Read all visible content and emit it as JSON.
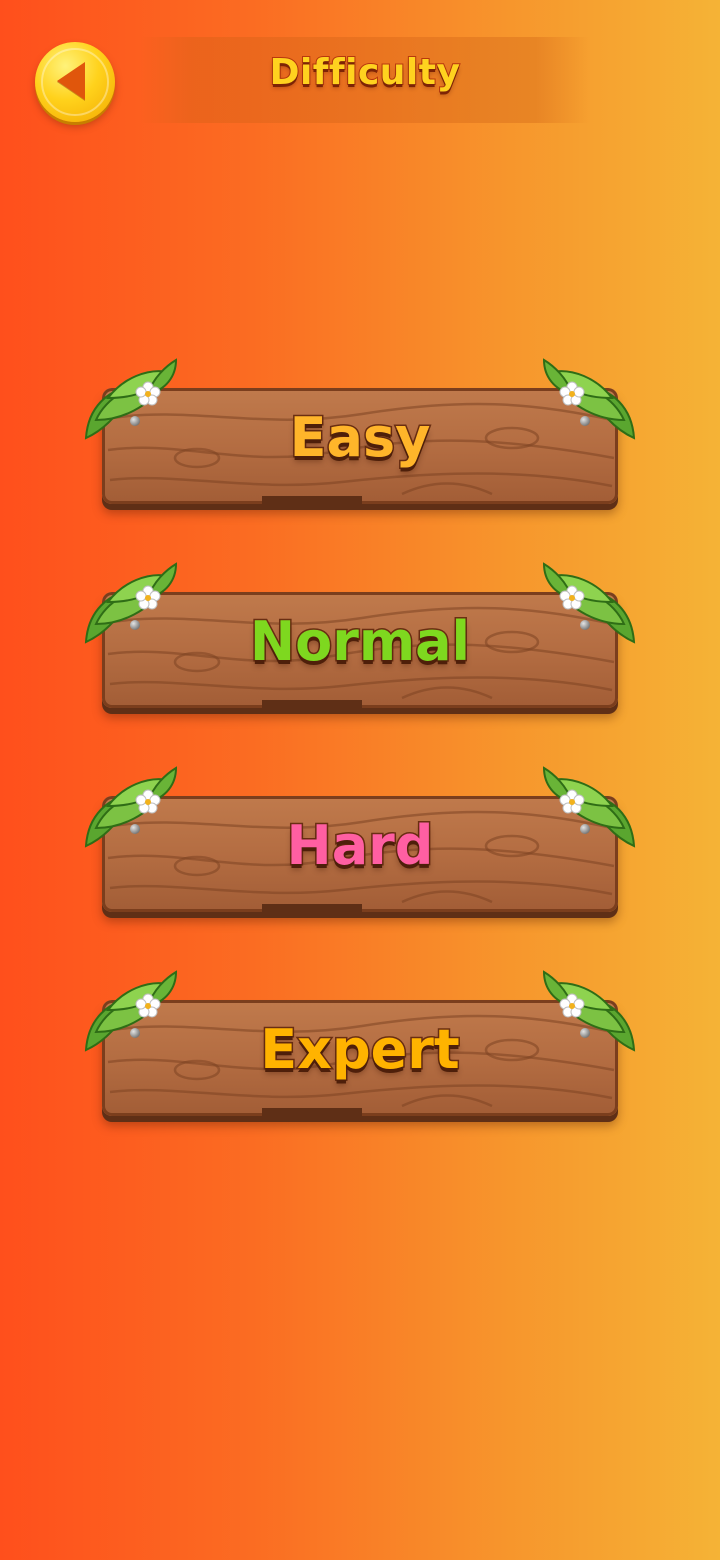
{
  "header": {
    "title": "Difficulty",
    "back_icon": "back-arrow-icon"
  },
  "levels": [
    {
      "label": "Easy",
      "color": "#ffb52a"
    },
    {
      "label": "Normal",
      "color": "#7ed81f"
    },
    {
      "label": "Hard",
      "color": "#ff5fa2"
    },
    {
      "label": "Expert",
      "color": "#ffb300"
    }
  ],
  "colors": {
    "background_start": "#ff4f1c",
    "background_end": "#f5b336",
    "wood": "#b46d42",
    "leaf": "#6db33f"
  }
}
